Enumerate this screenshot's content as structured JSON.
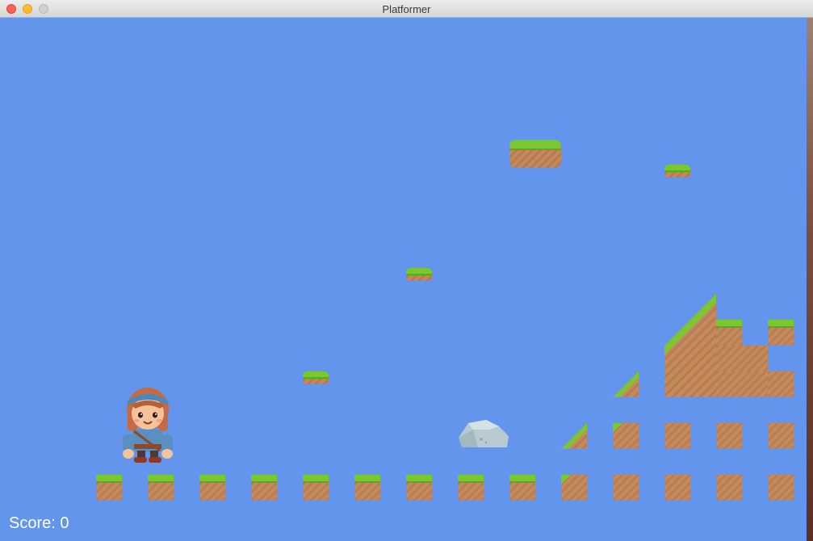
{
  "window": {
    "title": "Platformer"
  },
  "hud": {
    "score_label": "Score: 0"
  },
  "colors": {
    "sky": "#6495ed",
    "grass": "#7ac732",
    "dirt": "#c48a5c",
    "rock": "#b7cbd0"
  },
  "sprites": {
    "player": "adventurer-girl-sprite",
    "obstacle": "rock-sprite"
  }
}
